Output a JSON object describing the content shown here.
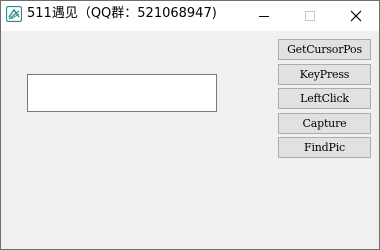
{
  "window": {
    "title": "511遇见（QQ群：521068947)",
    "icon": "app-icon",
    "controls": {
      "minimize_icon": "minimize-icon",
      "maximize_icon": "maximize-icon",
      "close_icon": "close-icon"
    }
  },
  "main": {
    "text_input_value": "",
    "buttons": [
      {
        "label": "GetCursorPos"
      },
      {
        "label": "KeyPress"
      },
      {
        "label": "LeftClick"
      },
      {
        "label": "Capture"
      },
      {
        "label": "FindPic"
      }
    ]
  },
  "colors": {
    "client_background": "#f0f0f0",
    "button_face": "#e1e1e1",
    "button_border": "#adadad",
    "icon_accent": "#2a8a8a"
  }
}
